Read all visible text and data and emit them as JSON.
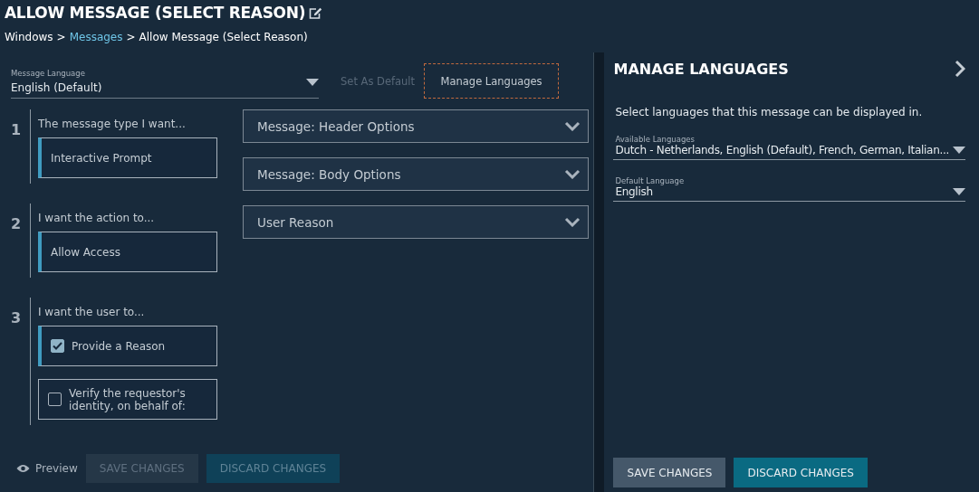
{
  "title": "ALLOW MESSAGE (SELECT REASON)",
  "breadcrumb": [
    {
      "text": "Windows",
      "link": false
    },
    {
      "text": ">",
      "link": false
    },
    {
      "text": "Messages",
      "link": true
    },
    {
      "text": ">",
      "link": false
    },
    {
      "text": "Allow Message (Select Reason)",
      "link": false
    }
  ],
  "language_select": {
    "label": "Message Language",
    "value": "English (Default)"
  },
  "set_default_button": {
    "label": "Set As Default",
    "disabled": true
  },
  "manage_languages_button": {
    "label": "Manage Languages"
  },
  "steps": [
    {
      "number": "1",
      "prompt": "The message type I want...",
      "options": [
        {
          "kind": "choice",
          "label": "Interactive Prompt",
          "selected": true
        }
      ]
    },
    {
      "number": "2",
      "prompt": "I want the action to...",
      "options": [
        {
          "kind": "choice",
          "label": "Allow Access",
          "selected": true
        }
      ]
    },
    {
      "number": "3",
      "prompt": "I want the user to...",
      "options": [
        {
          "kind": "checkbox",
          "label": "Provide a Reason",
          "selected": true,
          "checked": true
        },
        {
          "kind": "checkbox",
          "label": "Verify the requestor's identity, on behalf of:",
          "selected": false,
          "checked": false
        }
      ]
    }
  ],
  "dropdowns": [
    {
      "label": "Message: Header Options"
    },
    {
      "label": "Message: Body Options"
    },
    {
      "label": "User Reason"
    }
  ],
  "footer": {
    "preview": "Preview",
    "buttons": [
      {
        "kind": "save",
        "label": "SAVE CHANGES",
        "disabled": true
      },
      {
        "kind": "discard",
        "label": "DISCARD CHANGES",
        "disabled": true
      }
    ]
  },
  "panel": {
    "title": "MANAGE LANGUAGES",
    "description": "Select languages that this message can be displayed in.",
    "fields": [
      {
        "label": "Available Languages",
        "value": "Dutch - Netherlands, English (Default), French, German, Italian..."
      },
      {
        "label": "Default Language",
        "value": "English"
      }
    ],
    "buttons": [
      {
        "kind": "save",
        "label": "SAVE CHANGES",
        "disabled": false
      },
      {
        "kind": "discard",
        "label": "DISCARD CHANGES",
        "disabled": false
      }
    ]
  }
}
